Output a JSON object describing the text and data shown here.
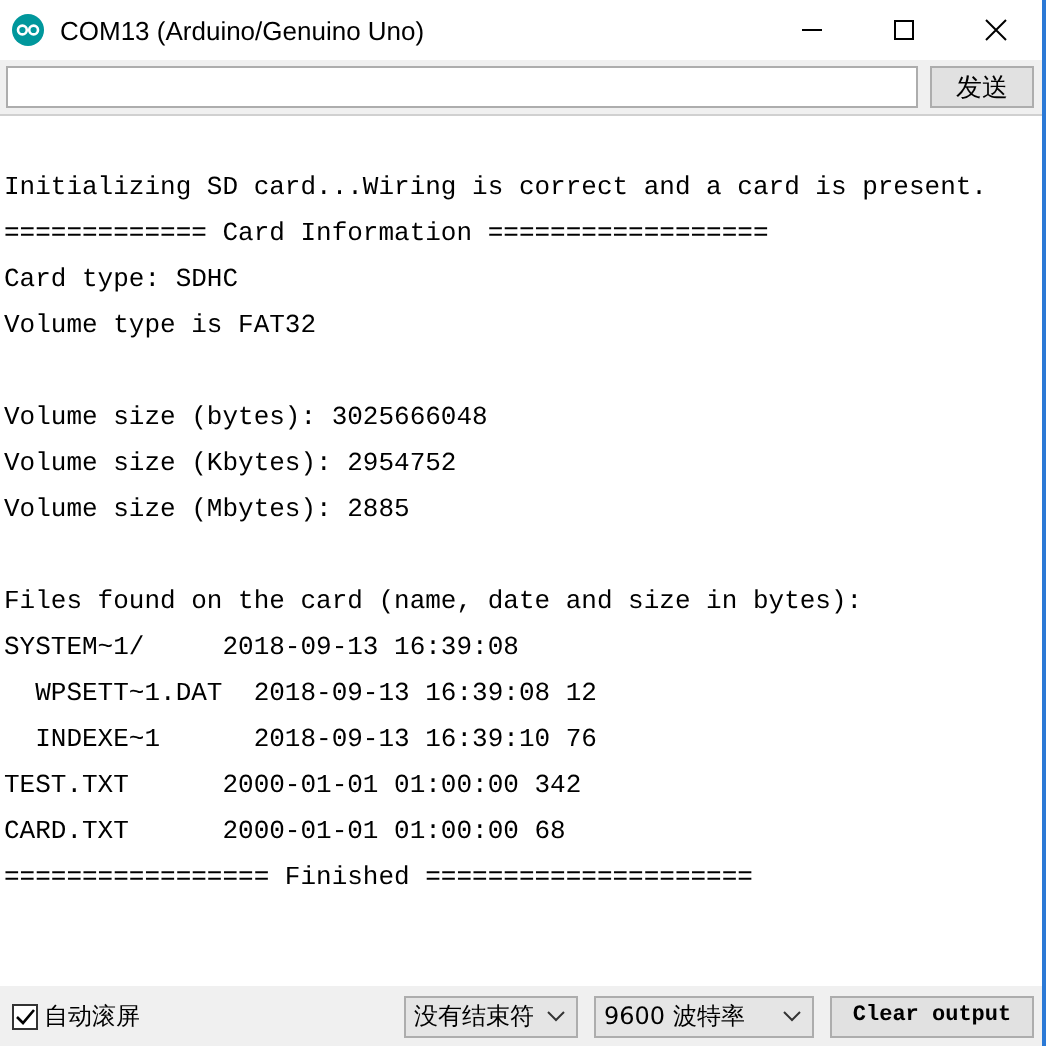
{
  "window": {
    "title": "COM13 (Arduino/Genuino Uno)"
  },
  "send_bar": {
    "button": "发送"
  },
  "output_blocks": [
    [
      "Initializing SD card...Wiring is correct and a card is present.",
      "============= Card Information ==================",
      "Card type: SDHC",
      "Volume type is FAT32"
    ],
    [
      "Volume size (bytes): 3025666048",
      "Volume size (Kbytes): 2954752",
      "Volume size (Mbytes): 2885"
    ],
    [
      "Files found on the card (name, date and size in bytes):",
      "SYSTEM~1/     2018-09-13 16:39:08",
      "  WPSETT~1.DAT  2018-09-13 16:39:08 12",
      "  INDEXE~1      2018-09-13 16:39:10 76",
      "TEST.TXT      2000-01-01 01:00:00 342",
      "CARD.TXT      2000-01-01 01:00:00 68",
      "================= Finished ====================="
    ]
  ],
  "status_bar": {
    "autoscroll": {
      "label": "自动滚屏",
      "checked": true
    },
    "line_ending": "没有结束符",
    "baud_rate": "9600 波特率",
    "clear_button": "Clear output"
  }
}
